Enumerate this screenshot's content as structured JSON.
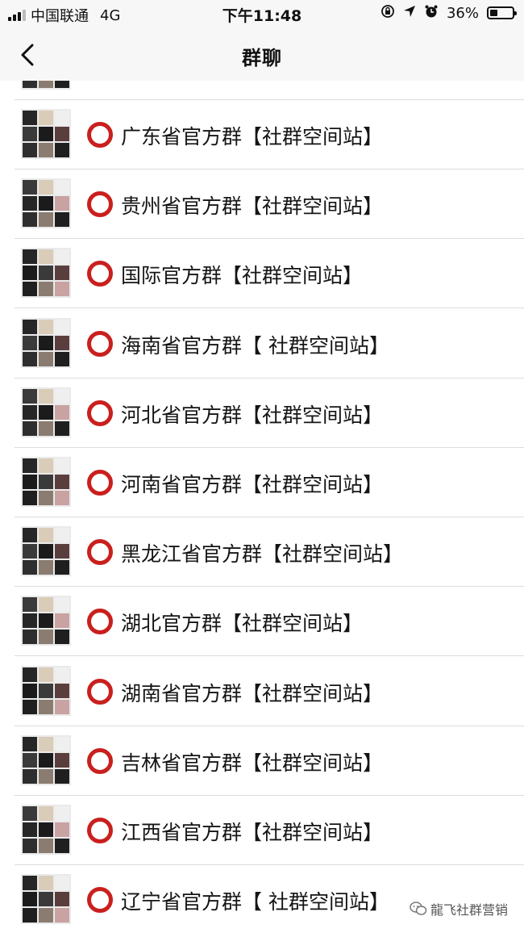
{
  "status_bar": {
    "carrier": "中国联通",
    "network": "4G",
    "time": "下午11:48",
    "battery_text": "36%",
    "battery_level": 0.36
  },
  "nav": {
    "title": "群聊"
  },
  "groups": [
    {
      "name": "广东省官方群【社群空间站】"
    },
    {
      "name": "贵州省官方群【社群空间站】"
    },
    {
      "name": "国际官方群【社群空间站】"
    },
    {
      "name": "海南省官方群【 社群空间站】"
    },
    {
      "name": "河北省官方群【社群空间站】"
    },
    {
      "name": "河南省官方群【社群空间站】"
    },
    {
      "name": "黑龙江省官方群【社群空间站】"
    },
    {
      "name": "湖北官方群【社群空间站】"
    },
    {
      "name": "湖南省官方群【社群空间站】"
    },
    {
      "name": "吉林省官方群【社群空间站】"
    },
    {
      "name": "江西省官方群【社群空间站】"
    },
    {
      "name": "辽宁省官方群【 社群空间站】"
    }
  ],
  "watermark": {
    "text": "龍飞社群营销"
  },
  "colors": {
    "ring": "#c9201e",
    "divider": "#dcdcdc",
    "bar_bg": "#f7f7f7"
  }
}
